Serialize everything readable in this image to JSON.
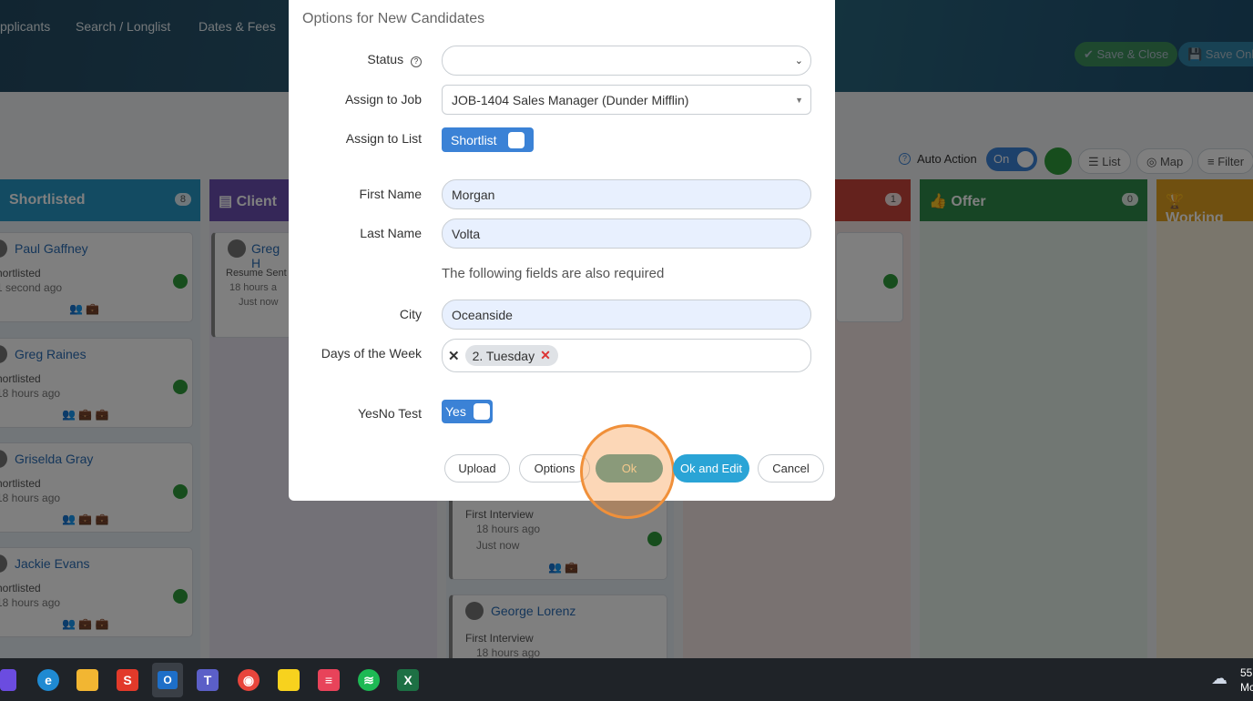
{
  "nav": {
    "applicants": "pplicants",
    "search": "Search / Longlist",
    "dates": "Dates & Fees"
  },
  "header_buttons": {
    "save_close": "✔ Save & Close",
    "save_only": "💾 Save Only"
  },
  "toolbar": {
    "auto_action_label": "Auto Action",
    "auto_action_toggle": "On",
    "list": "List",
    "map": "Map",
    "filter": "Filter"
  },
  "columns": {
    "shortlisted": {
      "title": "Shortlisted",
      "count": "8",
      "color": "#2796c4"
    },
    "client": {
      "title": "Client",
      "color": "#6a4fb0"
    },
    "hidden_red": {
      "count": "1",
      "color": "#c8443a"
    },
    "offer": {
      "title": "Offer",
      "count": "0",
      "color": "#2e8b4a"
    },
    "working": {
      "title": "Working",
      "color": "#e0a020"
    }
  },
  "cards": [
    {
      "name": "Paul Gaffney",
      "status": "hortlisted",
      "time": "1 second ago"
    },
    {
      "name": "Greg Raines",
      "status": "hortlisted",
      "time": "18 hours ago"
    },
    {
      "name": "Griselda Gray",
      "status": "hortlisted",
      "time": "18 hours ago"
    },
    {
      "name": "Jackie Evans",
      "status": "hortlisted",
      "time": "18 hours ago"
    }
  ],
  "client_card": {
    "name": "Greg H",
    "status": "Resume Sent",
    "time": "18 hours a",
    "note": "Just now"
  },
  "interview_cards": [
    {
      "status": "First Interview",
      "time": "18 hours ago",
      "note": "Just now"
    },
    {
      "name": "George Lorenz",
      "status": "First Interview",
      "time": "18 hours ago"
    }
  ],
  "modal": {
    "title": "Options for New Candidates",
    "status_label": "Status",
    "status_value": "",
    "job_label": "Assign to Job",
    "job_value": "JOB-1404 Sales Manager (Dunder Mifflin)",
    "list_label": "Assign to List",
    "list_value": "Shortlist",
    "first_name_label": "First Name",
    "first_name_value": "Morgan",
    "last_name_label": "Last Name",
    "last_name_value": "Volta",
    "required_note": "The following fields are also required",
    "city_label": "City",
    "city_value": "Oceanside",
    "days_label": "Days of the Week",
    "days_tag": "2. Tuesday",
    "yesno_label": "YesNo Test",
    "yesno_value": "Yes",
    "buttons": {
      "upload": "Upload",
      "options": "Options",
      "ok": "Ok",
      "ok_edit": "Ok and Edit",
      "cancel": "Cancel"
    }
  },
  "tray": {
    "line1": "55",
    "line2": "Mc"
  }
}
